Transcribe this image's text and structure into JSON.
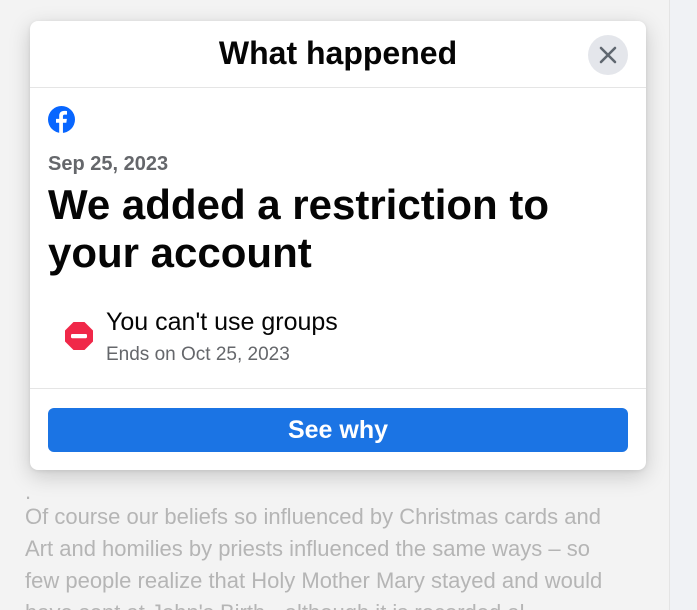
{
  "background": {
    "visible_lines": [
      ".",
      "Of course our beliefs so influenced by Christmas cards and",
      "Art and homilies by priests influenced the same ways – so",
      "few people realize that Holy Mother Mary stayed and would",
      "have sent at John's Birth - although it is recorded al"
    ]
  },
  "modal": {
    "title": "What happened",
    "close_icon": "close-icon",
    "brand_icon": "facebook-logo-icon",
    "date": "Sep 25, 2023",
    "headline": "We added a restriction to your account",
    "restriction": {
      "icon": "no-entry-icon",
      "title": "You can't use groups",
      "subtitle": "Ends on Oct 25, 2023"
    },
    "button_label": "See why"
  },
  "colors": {
    "brand_blue": "#1b74e4",
    "facebook_blue": "#0866ff",
    "restriction_red": "#f02849",
    "muted_text": "#65676b"
  }
}
